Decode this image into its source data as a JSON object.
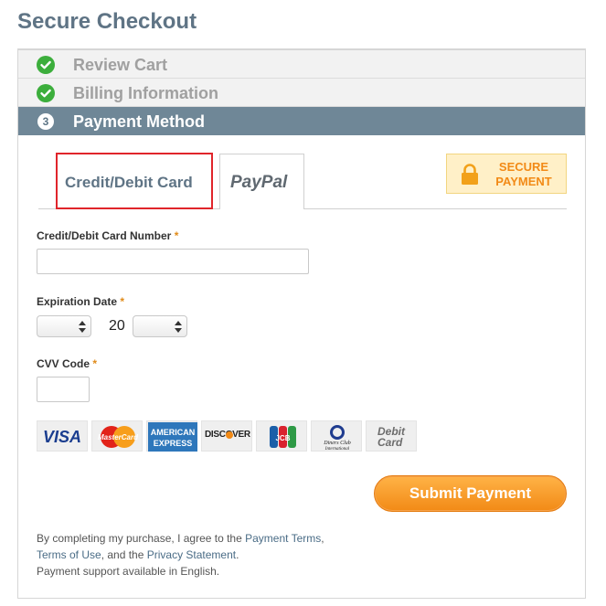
{
  "page": {
    "title": "Secure Checkout"
  },
  "steps": [
    {
      "number": "",
      "label": "Review Cart",
      "status": "done"
    },
    {
      "number": "",
      "label": "Billing Information",
      "status": "done"
    },
    {
      "number": "3",
      "label": "Payment Method",
      "status": "active"
    }
  ],
  "tabs": {
    "card_label": "Credit/Debit Card",
    "paypal_label": "PayPal"
  },
  "secure_badge": {
    "line1": "SECURE",
    "line2": "PAYMENT"
  },
  "form": {
    "card_number_label": "Credit/Debit Card Number",
    "expiration_label": "Expiration Date",
    "year_prefix": "20",
    "cvv_label": "CVV Code",
    "required_mark": "*",
    "card_number_value": "",
    "cvv_value": ""
  },
  "card_logos": {
    "visa": "VISA",
    "discover": "DISCOVER",
    "debit_line1": "Debit",
    "debit_line2": "Card",
    "mastercard_text": "MasterCard",
    "amex_line1": "AMERICAN",
    "amex_line2": "EXPRESS",
    "jcb": "JCB",
    "diners_line1": "Diners Club",
    "diners_line2": "International"
  },
  "submit": {
    "label": "Submit Payment"
  },
  "legal": {
    "part1": "By completing my purchase, I agree to the ",
    "link1": "Payment Terms",
    "part2": ", ",
    "link2": "Terms of Use",
    "part3": ", and the ",
    "link3": "Privacy Statement",
    "part4": ".",
    "support": "Payment support available in English."
  },
  "colors": {
    "accent": "#f28a16",
    "header_bar": "#6f8797",
    "check_green": "#3cae3c",
    "tab_highlight": "#e0252b"
  }
}
